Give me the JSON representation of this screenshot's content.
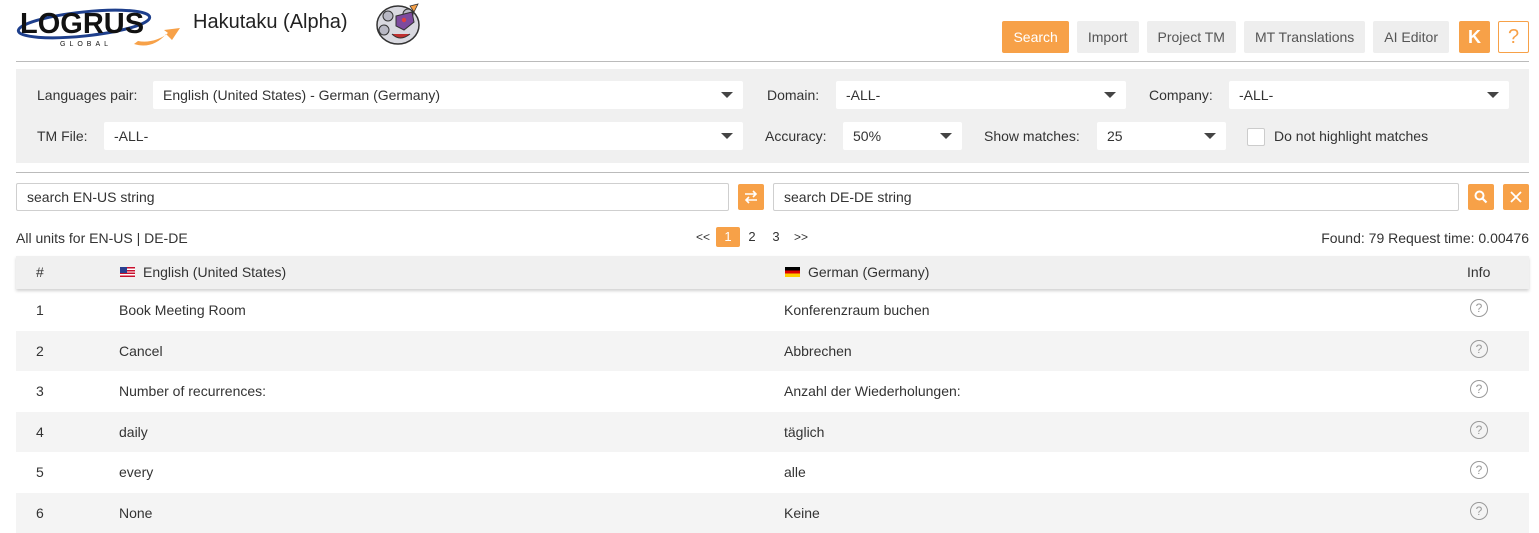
{
  "header": {
    "logo_text": "LOGRUS",
    "logo_subtext": "GLOBAL",
    "app_title": "Hakutaku (Alpha)",
    "nav": [
      {
        "label": "Search",
        "active": true
      },
      {
        "label": "Import",
        "active": false
      },
      {
        "label": "Project TM",
        "active": false
      },
      {
        "label": "MT Translations",
        "active": false
      },
      {
        "label": "AI Editor",
        "active": false
      }
    ],
    "user_initial": "K",
    "help_label": "?"
  },
  "filters": {
    "languages_label": "Languages pair:",
    "languages_value": "English (United States) - German (Germany)",
    "domain_label": "Domain:",
    "domain_value": "-ALL-",
    "company_label": "Company:",
    "company_value": "-ALL-",
    "tmfile_label": "TM File:",
    "tmfile_value": "-ALL-",
    "accuracy_label": "Accuracy:",
    "accuracy_value": "50%",
    "matches_label": "Show matches:",
    "matches_value": "25",
    "highlight_label": "Do not highlight matches",
    "highlight_checked": false
  },
  "search": {
    "source_placeholder": "search EN-US string",
    "target_placeholder": "search DE-DE string"
  },
  "results": {
    "units_text": "All units for EN-US | DE-DE",
    "pager": {
      "prev": "<<",
      "next": ">>",
      "pages": [
        "1",
        "2",
        "3"
      ],
      "current": "1"
    },
    "found_text": "Found: 79 Request time: 0.00476"
  },
  "table": {
    "headers": {
      "num": "#",
      "source": "English (United States)",
      "target": "German (Germany)",
      "info": "Info"
    },
    "rows": [
      {
        "num": "1",
        "source": "Book Meeting Room",
        "target": "Konferenzraum buchen"
      },
      {
        "num": "2",
        "source": "Cancel",
        "target": "Abbrechen"
      },
      {
        "num": "3",
        "source": "Number of recurrences:",
        "target": "Anzahl der Wiederholungen:"
      },
      {
        "num": "4",
        "source": "daily",
        "target": "täglich"
      },
      {
        "num": "5",
        "source": "every",
        "target": "alle"
      },
      {
        "num": "6",
        "source": "None",
        "target": "Keine"
      }
    ]
  },
  "colors": {
    "accent": "#f7a148",
    "panel": "#f0f0f0",
    "logo_blue": "#1e3f8c"
  }
}
